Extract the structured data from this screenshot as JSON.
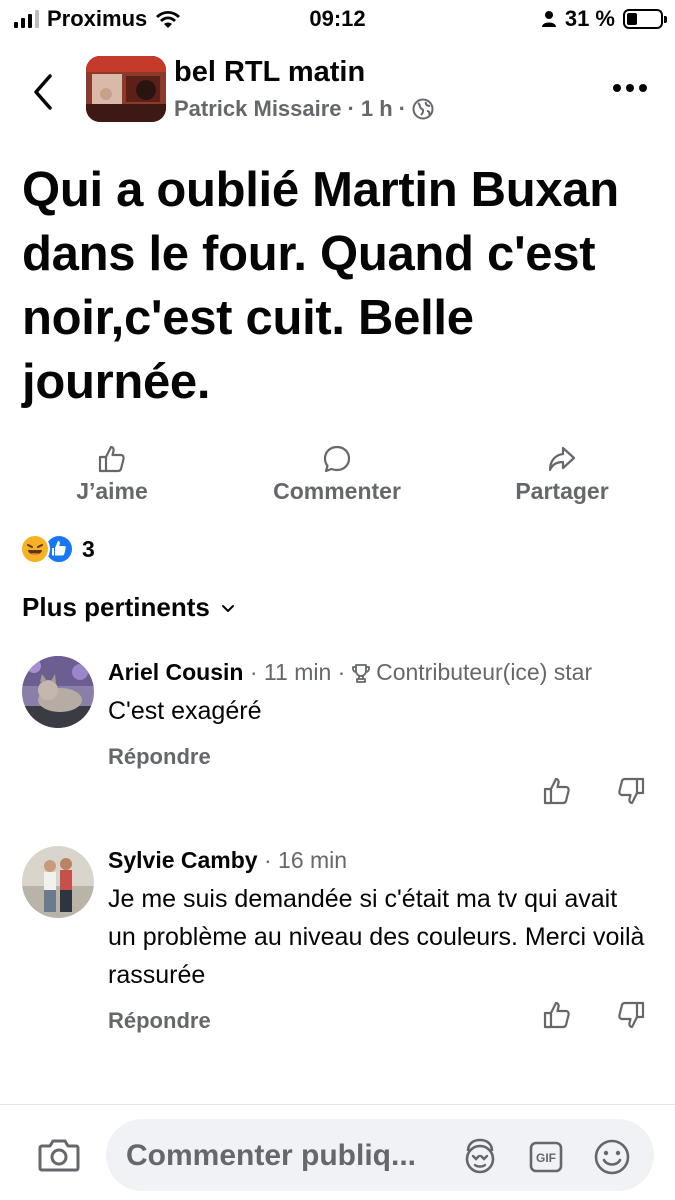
{
  "status_bar": {
    "carrier": "Proximus",
    "time": "09:12",
    "battery": "31 %",
    "battery_level": 0.31
  },
  "header": {
    "page_name": "bel RTL matin",
    "author": "Patrick Missaire",
    "time_ago": "1 h",
    "back_icon": "chevron-left-icon",
    "more_icon": "more-horizontal-icon"
  },
  "post": {
    "text": "Qui a oublié Martin Buxan dans le four. Quand c'est noir,c'est cuit. Belle journée."
  },
  "actions": {
    "like": "J’aime",
    "comment": "Commenter",
    "share": "Partager"
  },
  "reactions": {
    "count": "3",
    "types": [
      "haha",
      "like"
    ]
  },
  "sort": {
    "label": "Plus pertinents"
  },
  "comments": [
    {
      "author": "Ariel Cousin",
      "time": "11 min",
      "badge": "Contributeur(ice) star",
      "text": "C'est exagéré",
      "reply": "Répondre"
    },
    {
      "author": "Sylvie Camby",
      "time": "16 min",
      "badge": "",
      "text": "Je me suis demandée si c'était ma tv qui avait un problème au niveau des couleurs. Merci voilà rassurée",
      "reply": "Répondre"
    }
  ],
  "composer": {
    "placeholder": "Commenter publiq..."
  }
}
